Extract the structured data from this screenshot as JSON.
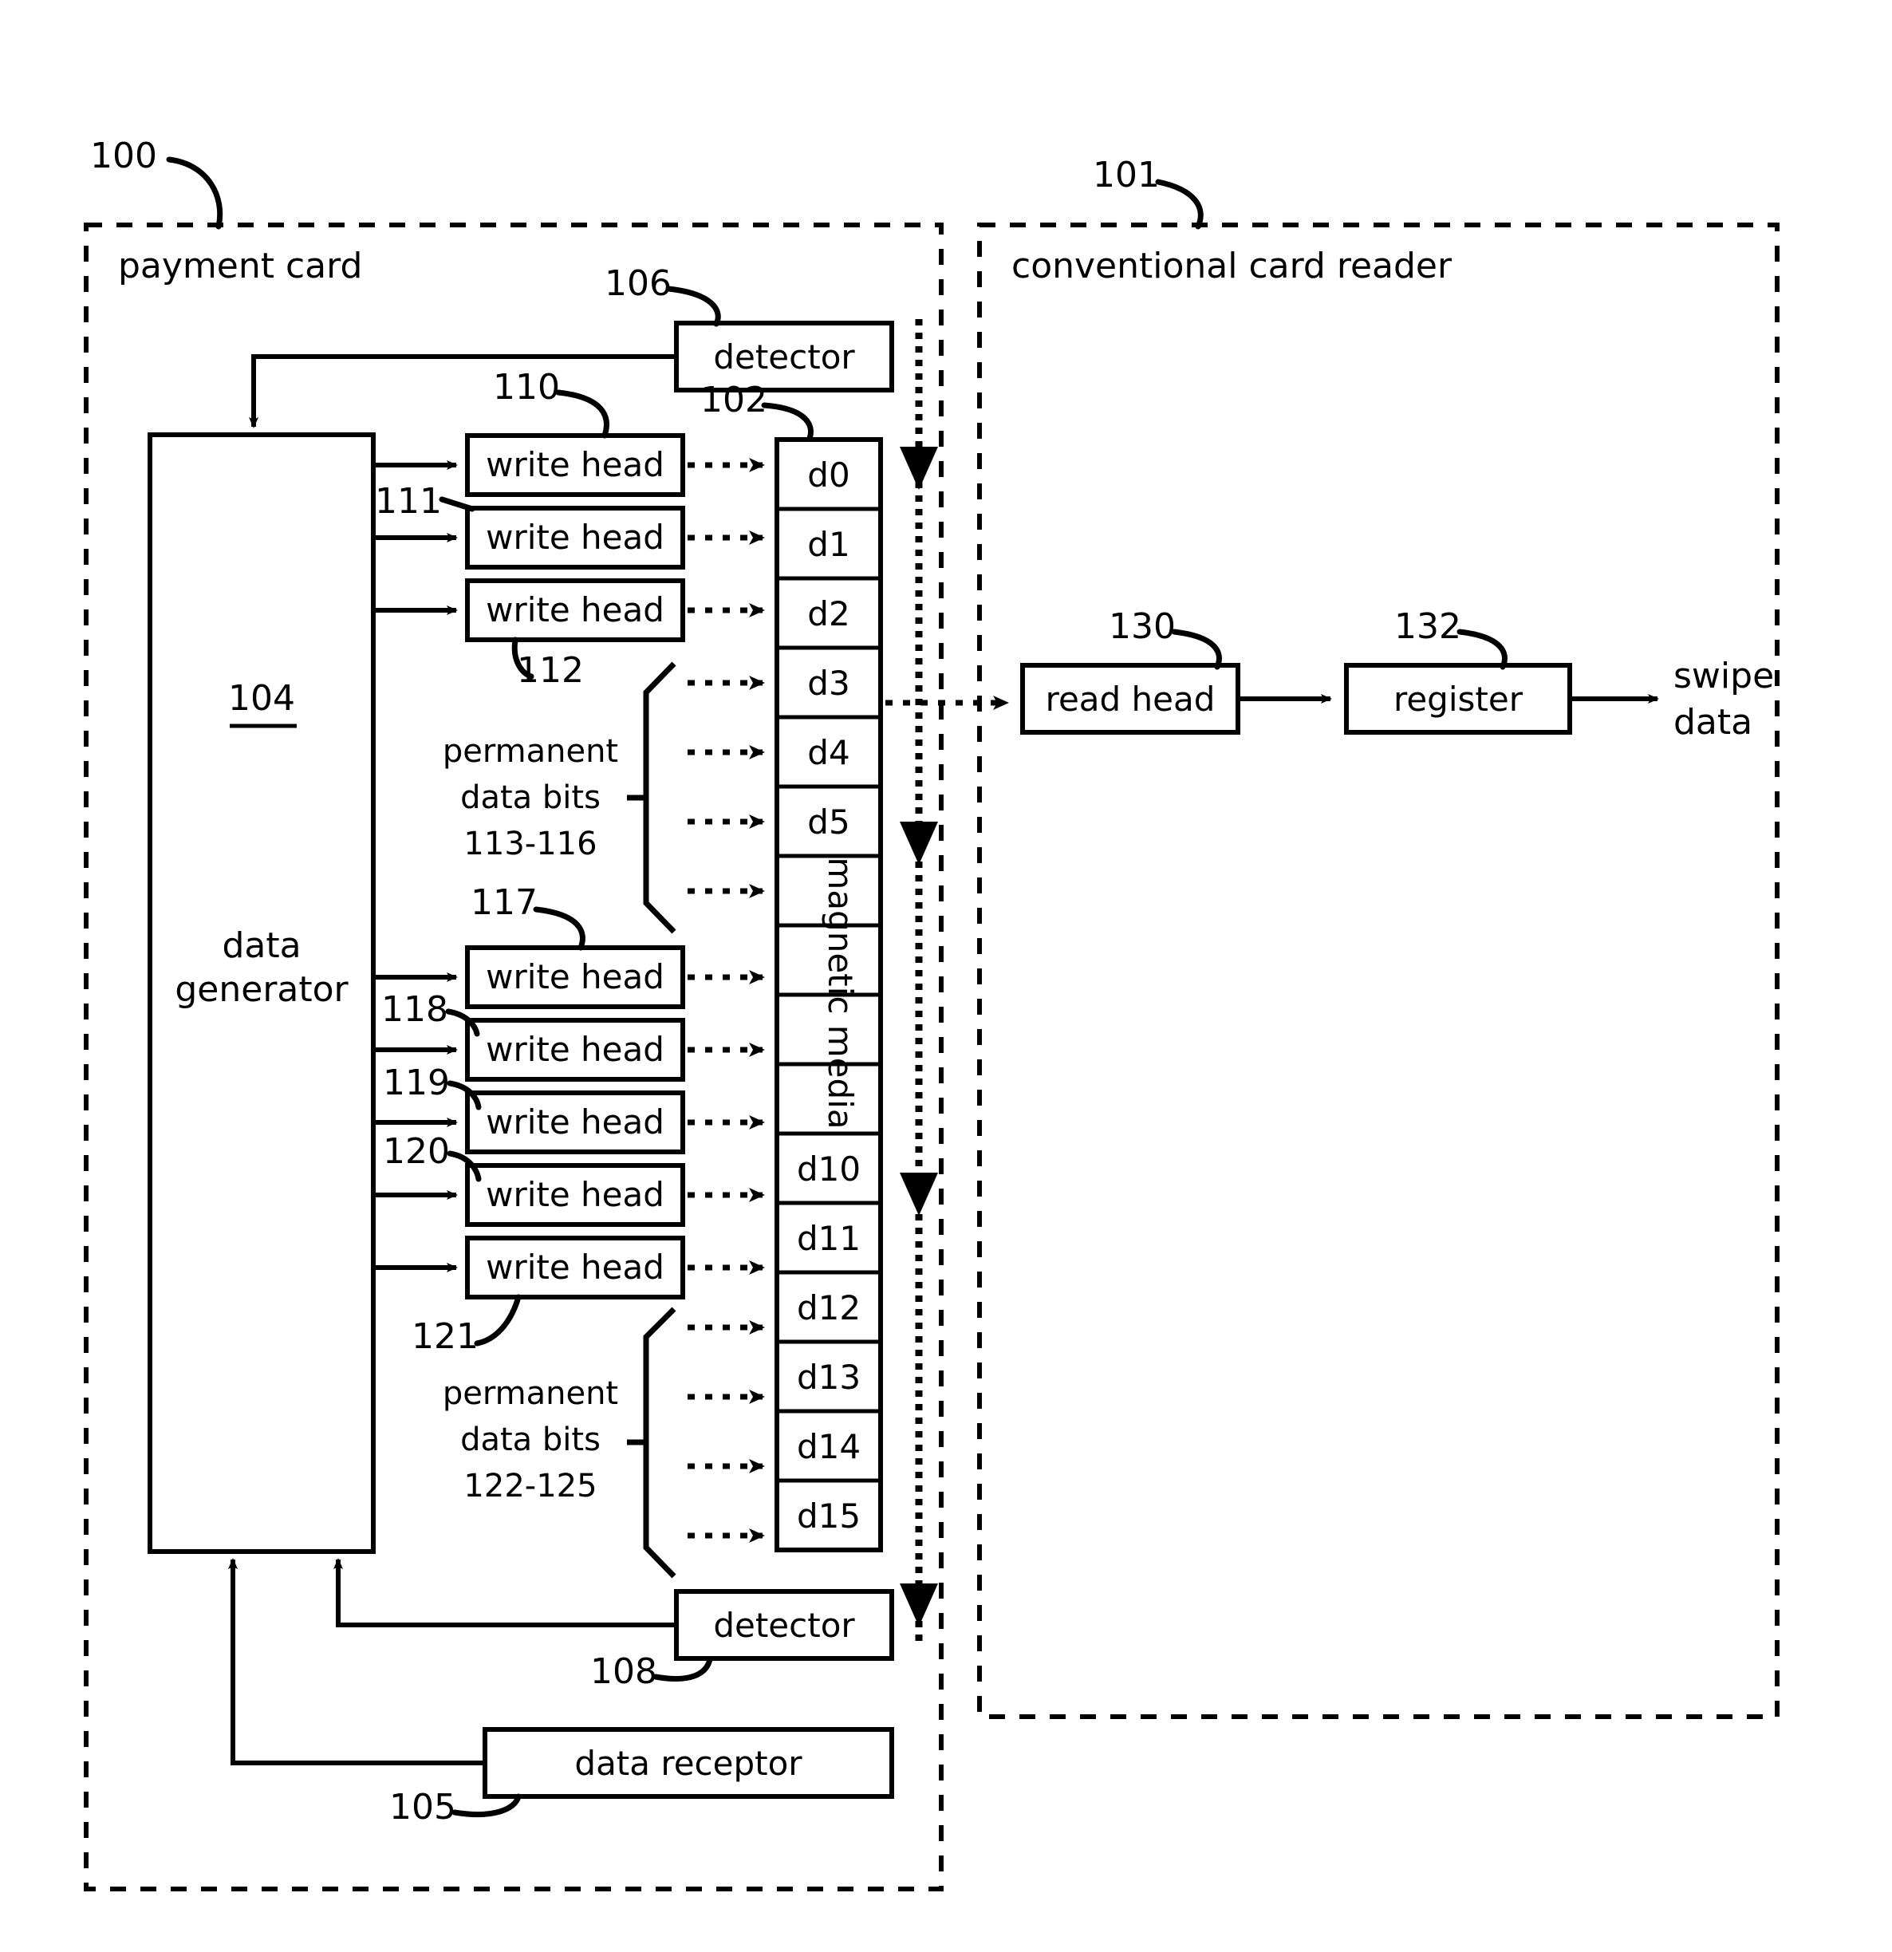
{
  "figure": {
    "panels": [
      {
        "ref": "100",
        "label": "payment card"
      },
      {
        "ref": "101",
        "label": "conventional card reader"
      }
    ],
    "blocks": {
      "data_generator": {
        "ref": "104",
        "line1": "data",
        "line2": "generator"
      },
      "detector_top": {
        "ref": "106",
        "label": "detector"
      },
      "detector_bottom": {
        "ref": "108",
        "label": "detector"
      },
      "data_receptor": {
        "ref": "105",
        "label": "data receptor"
      },
      "read_head": {
        "ref": "130",
        "label": "read head"
      },
      "register": {
        "ref": "132",
        "label": "register"
      },
      "magnetic_media": {
        "ref": "102",
        "label": "magnetic media"
      },
      "swipe_output": {
        "line1": "swipe",
        "line2": "data"
      }
    },
    "write_heads": [
      {
        "ref": "110",
        "label": "write head"
      },
      {
        "ref": "111",
        "label": "write head"
      },
      {
        "ref": "112",
        "label": "write head"
      },
      {
        "ref": "117",
        "label": "write head"
      },
      {
        "ref": "118",
        "label": "write head"
      },
      {
        "ref": "119",
        "label": "write head"
      },
      {
        "ref": "120",
        "label": "write head"
      },
      {
        "ref": "121",
        "label": "write head"
      }
    ],
    "permanent_groups": [
      {
        "line1": "permanent",
        "line2": "data bits",
        "line3": "113-116"
      },
      {
        "line1": "permanent",
        "line2": "data bits",
        "line3": "122-125"
      }
    ],
    "media_cells": [
      {
        "id": "d0",
        "label": "d0"
      },
      {
        "id": "d1",
        "label": "d1"
      },
      {
        "id": "d2",
        "label": "d2"
      },
      {
        "id": "d3",
        "label": "d3"
      },
      {
        "id": "d4",
        "label": "d4"
      },
      {
        "id": "d5",
        "label": "d5"
      },
      {
        "id": "d6",
        "label": ""
      },
      {
        "id": "d7",
        "label": ""
      },
      {
        "id": "d8",
        "label": ""
      },
      {
        "id": "d9",
        "label": ""
      },
      {
        "id": "d10",
        "label": "d10"
      },
      {
        "id": "d11",
        "label": "d11"
      },
      {
        "id": "d12",
        "label": "d12"
      },
      {
        "id": "d13",
        "label": "d13"
      },
      {
        "id": "d14",
        "label": "d14"
      },
      {
        "id": "d15",
        "label": "d15"
      }
    ],
    "colors": {
      "stroke": "#000000",
      "background": "#ffffff"
    }
  }
}
